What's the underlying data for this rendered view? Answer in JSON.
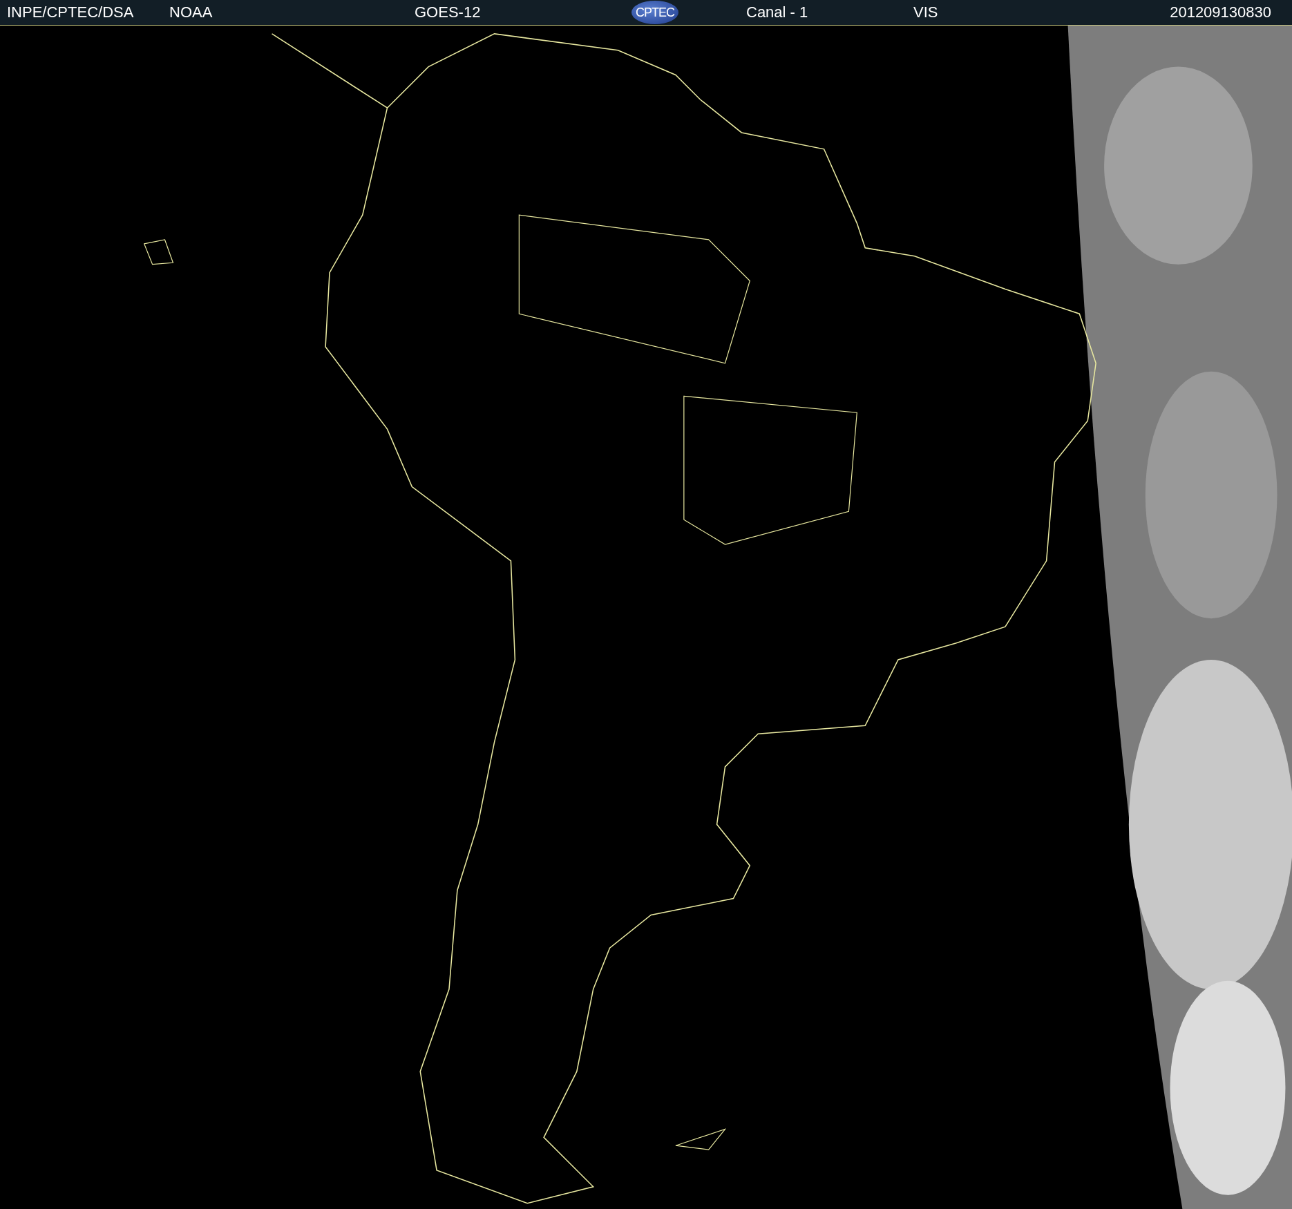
{
  "header": {
    "source": "INPE/CPTEC/DSA",
    "agency": "NOAA",
    "satellite": "GOES-12",
    "logo": "CPTEC",
    "channel": "Canal - 1",
    "band": "VIS",
    "timestamp": "201209130830"
  }
}
